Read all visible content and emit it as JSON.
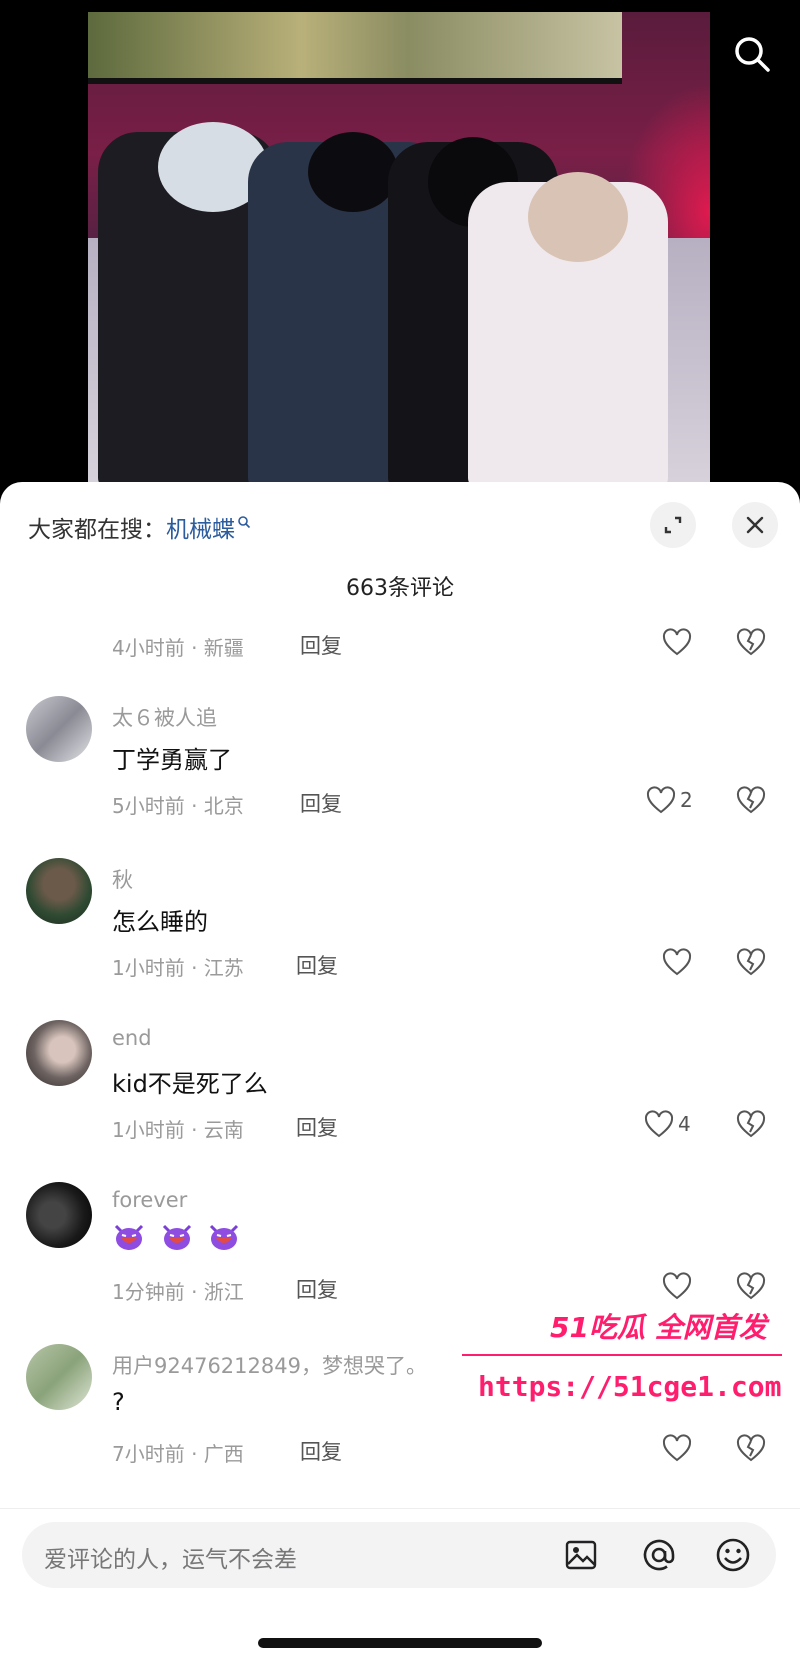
{
  "header": {
    "search_icon": "search-icon"
  },
  "sheet": {
    "trending_prefix": "大家都在搜：",
    "trending_keyword": "机械蝶",
    "comment_count": "663条评论"
  },
  "comments": [
    {
      "meta": "4小时前 · 新疆",
      "reply": "回复",
      "likes": ""
    },
    {
      "user": "太６被人追",
      "text": "丁学勇赢了",
      "meta": "5小时前 · 北京",
      "reply": "回复",
      "likes": "2"
    },
    {
      "user": "秋",
      "text": "怎么睡的",
      "meta": "1小时前 · 江苏",
      "reply": "回复",
      "likes": ""
    },
    {
      "user": "end",
      "text": "kid不是死了么",
      "meta": "1小时前 · 云南",
      "reply": "回复",
      "likes": "4"
    },
    {
      "user": "forever",
      "text": "",
      "emojis": [
        "devil-laugh-emoji",
        "devil-laugh-emoji",
        "devil-laugh-emoji"
      ],
      "meta": "1分钟前 · 浙江",
      "reply": "回复",
      "likes": ""
    },
    {
      "user": "用户92476212849，梦想哭了。",
      "text": "?",
      "meta": "7小时前 · 广西",
      "reply": "回复",
      "likes": ""
    }
  ],
  "watermark": {
    "title": "51吃瓜 全网首发",
    "url": "https://51cge1.com"
  },
  "input": {
    "placeholder": "爱评论的人，运气不会差"
  },
  "colors": {
    "accent_link": "#2a5c9e",
    "watermark": "#ff1e6e"
  }
}
